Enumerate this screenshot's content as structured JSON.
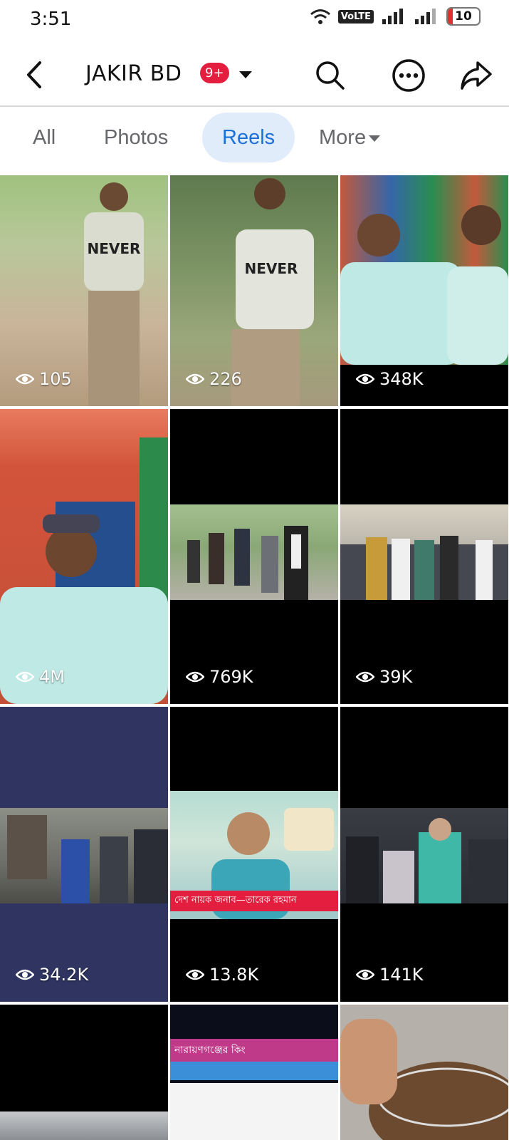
{
  "status_bar": {
    "time": "3:51",
    "network": "VoLTE",
    "battery": "10"
  },
  "header": {
    "title": "JAKIR BD",
    "badge": "9+"
  },
  "tabs": [
    {
      "label": "All",
      "active": false
    },
    {
      "label": "Photos",
      "active": false
    },
    {
      "label": "Reels",
      "active": true
    },
    {
      "label": "More",
      "active": false
    }
  ],
  "reels": [
    {
      "views": "105"
    },
    {
      "views": "226"
    },
    {
      "views": "348K"
    },
    {
      "views": "4M"
    },
    {
      "views": "769K"
    },
    {
      "views": "39K"
    },
    {
      "views": "34.2K"
    },
    {
      "views": "13.8K",
      "caption": "দেশ নায়ক জনাব—তারেক রহমান"
    },
    {
      "views": "141K"
    },
    {
      "views": ""
    },
    {
      "views": "",
      "caption": "নারায়ণগঞ্জের কিং"
    },
    {
      "views": ""
    }
  ],
  "colors": {
    "accent": "#1b6fd8",
    "active_tab_bg": "#e1ecfb",
    "badge": "#e41e3f"
  }
}
